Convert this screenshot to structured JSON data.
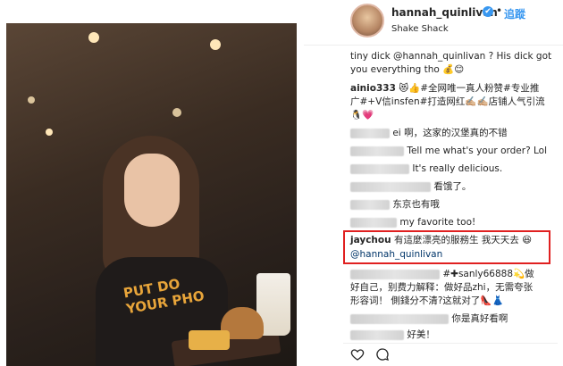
{
  "header": {
    "username": "hannah_quinlivan",
    "verified_glyph": "✔",
    "separator": "•",
    "follow_label": "追蹤",
    "location": "Shake Shack"
  },
  "photo": {
    "shirt_text_line1": "PUT DO",
    "shirt_text_line2": "YOUR PHO"
  },
  "comments": [
    {
      "user": "",
      "text": "tiny dick @hannah_quinlivan ? His dick got"
    },
    {
      "user": "",
      "text": "you everything tho 💰😊"
    },
    {
      "user": "ainio333",
      "text": "😻👍#全网唯一真人粉赞#专业推"
    },
    {
      "user": "",
      "text": "广#+V信insfen#打造网红✍🏼✍🏼店铺人气引流"
    },
    {
      "user": "",
      "text": "🐧💗"
    },
    {
      "user": "ei",
      "text": "啊，这家的汉堡真的不错"
    },
    {
      "user": "",
      "text": "Tell me what's your order? Lol"
    },
    {
      "user": "",
      "text": "It's really delicious."
    },
    {
      "user": "",
      "text": "看饿了。"
    },
    {
      "user": "",
      "text": "东京也有哦"
    },
    {
      "user": "",
      "text": "my favorite too!"
    },
    {
      "user": "jaychou",
      "text": "有這麼漂亮的服務生 我天天去 😆"
    },
    {
      "user": "",
      "text": "@hannah_quinlivan"
    },
    {
      "user": "",
      "text": "#✚sanly66888💫做"
    },
    {
      "user": "",
      "text": "好自己，别费力解释：做好品zhi，无需夸张"
    },
    {
      "user": "",
      "text": "形容词！ 側錢分不清?这就对了👠👗"
    },
    {
      "user": "",
      "text": "你是真好看啊"
    },
    {
      "user": "",
      "text": "好美！"
    }
  ],
  "icons": {
    "like": "heart-icon",
    "comment": "comment-icon"
  }
}
